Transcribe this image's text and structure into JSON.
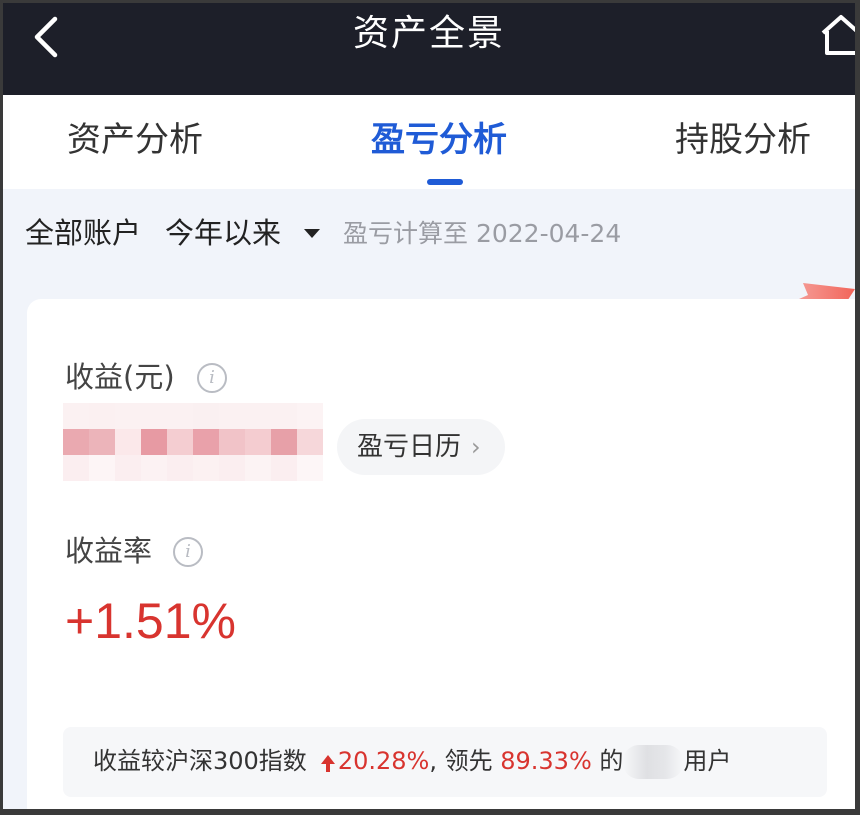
{
  "header": {
    "title": "资产全景"
  },
  "tabs": [
    {
      "label": "资产分析",
      "active": false
    },
    {
      "label": "盈亏分析",
      "active": true
    },
    {
      "label": "持股分析",
      "active": false
    }
  ],
  "filters": {
    "account": "全部账户",
    "period": "今年以来",
    "calc_date": "盈亏计算至 2022-04-24"
  },
  "profit": {
    "label": "收益(元)",
    "value_obscured": true,
    "calendar_button": "盈亏日历"
  },
  "rate": {
    "label": "收益率",
    "value": "+1.51%"
  },
  "compare": {
    "prefix": "收益较沪深300指数",
    "index_change": "20.28%",
    "mid": ", 领先",
    "lead_pct": "89.33%",
    "of": "的",
    "suffix": "用户"
  },
  "colors": {
    "accent": "#1f5bd6",
    "gain": "#d8342f",
    "topbar": "#1d1f29"
  },
  "icons": {
    "back": "chevron-left-icon",
    "home": "home-icon",
    "info": "info-icon",
    "dropdown": "caret-down-icon",
    "calendar_chevron": "chevron-right-icon",
    "up_arrow": "arrow-up-icon"
  }
}
